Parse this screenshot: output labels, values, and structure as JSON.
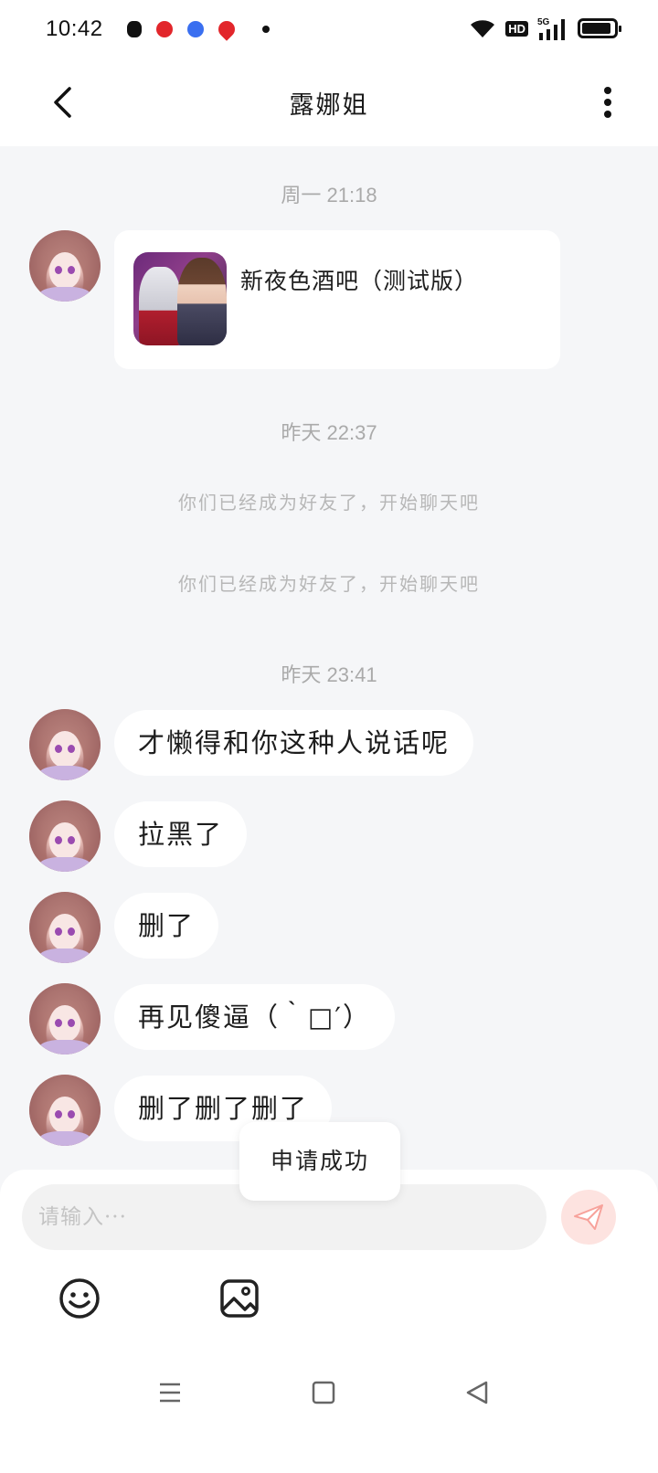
{
  "status_bar": {
    "time": "10:42",
    "network": "5G",
    "hd_label": "HD",
    "app_icons": [
      {
        "name": "tiktok-icon",
        "color": "#111111"
      },
      {
        "name": "red-app-icon",
        "color": "#e2262b"
      },
      {
        "name": "baidu-icon",
        "color": "#3a6ff0"
      },
      {
        "name": "map-pin-icon",
        "color": "#e2262b"
      },
      {
        "name": "dot-icon",
        "color": "#111111"
      }
    ]
  },
  "header": {
    "title": "露娜姐"
  },
  "messages": {
    "timestamp_1": "周一 21:18",
    "card_title": "新夜色酒吧（测试版）",
    "timestamp_2": "昨天 22:37",
    "system_1": "你们已经成为好友了，开始聊天吧",
    "system_2": "你们已经成为好友了，开始聊天吧",
    "timestamp_3": "昨天 23:41",
    "bubble_1": "才懒得和你这种人说话呢",
    "bubble_2": "拉黑了",
    "bubble_3": "删了",
    "bubble_4": "再见傻逼（｀□′）",
    "bubble_5": "删了删了删了"
  },
  "toast": {
    "text": "申请成功"
  },
  "input": {
    "placeholder": "请输入···",
    "value": ""
  },
  "colors": {
    "background": "#f5f6f8",
    "bubble": "#ffffff",
    "send_button": "#fde3e0",
    "send_icon": "#f7a29b"
  }
}
